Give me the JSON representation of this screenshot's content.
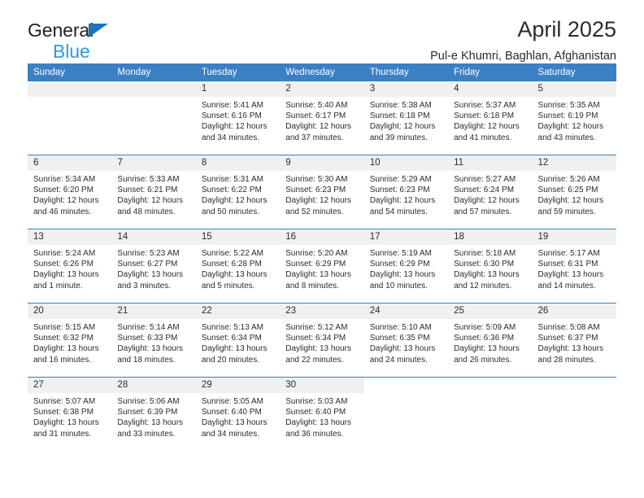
{
  "brand": {
    "line1": "General",
    "line2": "Blue",
    "triangle_color": "#1874bb",
    "line2_color": "#2e9bde"
  },
  "header": {
    "title": "April 2025",
    "subtitle": "Pul-e Khumri, Baghlan, Afghanistan"
  },
  "colors": {
    "header_band": "#3b7fc4",
    "daynum_band": "#f0f0f0",
    "text": "#2b2b2b"
  },
  "weekday_headers": [
    "Sunday",
    "Monday",
    "Tuesday",
    "Wednesday",
    "Thursday",
    "Friday",
    "Saturday"
  ],
  "weeks": [
    [
      {
        "day": "",
        "blank": true
      },
      {
        "day": "",
        "blank": true
      },
      {
        "day": "1",
        "sunrise": "Sunrise: 5:41 AM",
        "sunset": "Sunset: 6:16 PM",
        "daylight_line1": "Daylight: 12 hours",
        "daylight_line2": "and 34 minutes."
      },
      {
        "day": "2",
        "sunrise": "Sunrise: 5:40 AM",
        "sunset": "Sunset: 6:17 PM",
        "daylight_line1": "Daylight: 12 hours",
        "daylight_line2": "and 37 minutes."
      },
      {
        "day": "3",
        "sunrise": "Sunrise: 5:38 AM",
        "sunset": "Sunset: 6:18 PM",
        "daylight_line1": "Daylight: 12 hours",
        "daylight_line2": "and 39 minutes."
      },
      {
        "day": "4",
        "sunrise": "Sunrise: 5:37 AM",
        "sunset": "Sunset: 6:18 PM",
        "daylight_line1": "Daylight: 12 hours",
        "daylight_line2": "and 41 minutes."
      },
      {
        "day": "5",
        "sunrise": "Sunrise: 5:35 AM",
        "sunset": "Sunset: 6:19 PM",
        "daylight_line1": "Daylight: 12 hours",
        "daylight_line2": "and 43 minutes."
      }
    ],
    [
      {
        "day": "6",
        "sunrise": "Sunrise: 5:34 AM",
        "sunset": "Sunset: 6:20 PM",
        "daylight_line1": "Daylight: 12 hours",
        "daylight_line2": "and 46 minutes."
      },
      {
        "day": "7",
        "sunrise": "Sunrise: 5:33 AM",
        "sunset": "Sunset: 6:21 PM",
        "daylight_line1": "Daylight: 12 hours",
        "daylight_line2": "and 48 minutes."
      },
      {
        "day": "8",
        "sunrise": "Sunrise: 5:31 AM",
        "sunset": "Sunset: 6:22 PM",
        "daylight_line1": "Daylight: 12 hours",
        "daylight_line2": "and 50 minutes."
      },
      {
        "day": "9",
        "sunrise": "Sunrise: 5:30 AM",
        "sunset": "Sunset: 6:23 PM",
        "daylight_line1": "Daylight: 12 hours",
        "daylight_line2": "and 52 minutes."
      },
      {
        "day": "10",
        "sunrise": "Sunrise: 5:29 AM",
        "sunset": "Sunset: 6:23 PM",
        "daylight_line1": "Daylight: 12 hours",
        "daylight_line2": "and 54 minutes."
      },
      {
        "day": "11",
        "sunrise": "Sunrise: 5:27 AM",
        "sunset": "Sunset: 6:24 PM",
        "daylight_line1": "Daylight: 12 hours",
        "daylight_line2": "and 57 minutes."
      },
      {
        "day": "12",
        "sunrise": "Sunrise: 5:26 AM",
        "sunset": "Sunset: 6:25 PM",
        "daylight_line1": "Daylight: 12 hours",
        "daylight_line2": "and 59 minutes."
      }
    ],
    [
      {
        "day": "13",
        "sunrise": "Sunrise: 5:24 AM",
        "sunset": "Sunset: 6:26 PM",
        "daylight_line1": "Daylight: 13 hours",
        "daylight_line2": "and 1 minute."
      },
      {
        "day": "14",
        "sunrise": "Sunrise: 5:23 AM",
        "sunset": "Sunset: 6:27 PM",
        "daylight_line1": "Daylight: 13 hours",
        "daylight_line2": "and 3 minutes."
      },
      {
        "day": "15",
        "sunrise": "Sunrise: 5:22 AM",
        "sunset": "Sunset: 6:28 PM",
        "daylight_line1": "Daylight: 13 hours",
        "daylight_line2": "and 5 minutes."
      },
      {
        "day": "16",
        "sunrise": "Sunrise: 5:20 AM",
        "sunset": "Sunset: 6:29 PM",
        "daylight_line1": "Daylight: 13 hours",
        "daylight_line2": "and 8 minutes."
      },
      {
        "day": "17",
        "sunrise": "Sunrise: 5:19 AM",
        "sunset": "Sunset: 6:29 PM",
        "daylight_line1": "Daylight: 13 hours",
        "daylight_line2": "and 10 minutes."
      },
      {
        "day": "18",
        "sunrise": "Sunrise: 5:18 AM",
        "sunset": "Sunset: 6:30 PM",
        "daylight_line1": "Daylight: 13 hours",
        "daylight_line2": "and 12 minutes."
      },
      {
        "day": "19",
        "sunrise": "Sunrise: 5:17 AM",
        "sunset": "Sunset: 6:31 PM",
        "daylight_line1": "Daylight: 13 hours",
        "daylight_line2": "and 14 minutes."
      }
    ],
    [
      {
        "day": "20",
        "sunrise": "Sunrise: 5:15 AM",
        "sunset": "Sunset: 6:32 PM",
        "daylight_line1": "Daylight: 13 hours",
        "daylight_line2": "and 16 minutes."
      },
      {
        "day": "21",
        "sunrise": "Sunrise: 5:14 AM",
        "sunset": "Sunset: 6:33 PM",
        "daylight_line1": "Daylight: 13 hours",
        "daylight_line2": "and 18 minutes."
      },
      {
        "day": "22",
        "sunrise": "Sunrise: 5:13 AM",
        "sunset": "Sunset: 6:34 PM",
        "daylight_line1": "Daylight: 13 hours",
        "daylight_line2": "and 20 minutes."
      },
      {
        "day": "23",
        "sunrise": "Sunrise: 5:12 AM",
        "sunset": "Sunset: 6:34 PM",
        "daylight_line1": "Daylight: 13 hours",
        "daylight_line2": "and 22 minutes."
      },
      {
        "day": "24",
        "sunrise": "Sunrise: 5:10 AM",
        "sunset": "Sunset: 6:35 PM",
        "daylight_line1": "Daylight: 13 hours",
        "daylight_line2": "and 24 minutes."
      },
      {
        "day": "25",
        "sunrise": "Sunrise: 5:09 AM",
        "sunset": "Sunset: 6:36 PM",
        "daylight_line1": "Daylight: 13 hours",
        "daylight_line2": "and 26 minutes."
      },
      {
        "day": "26",
        "sunrise": "Sunrise: 5:08 AM",
        "sunset": "Sunset: 6:37 PM",
        "daylight_line1": "Daylight: 13 hours",
        "daylight_line2": "and 28 minutes."
      }
    ],
    [
      {
        "day": "27",
        "sunrise": "Sunrise: 5:07 AM",
        "sunset": "Sunset: 6:38 PM",
        "daylight_line1": "Daylight: 13 hours",
        "daylight_line2": "and 31 minutes."
      },
      {
        "day": "28",
        "sunrise": "Sunrise: 5:06 AM",
        "sunset": "Sunset: 6:39 PM",
        "daylight_line1": "Daylight: 13 hours",
        "daylight_line2": "and 33 minutes."
      },
      {
        "day": "29",
        "sunrise": "Sunrise: 5:05 AM",
        "sunset": "Sunset: 6:40 PM",
        "daylight_line1": "Daylight: 13 hours",
        "daylight_line2": "and 34 minutes."
      },
      {
        "day": "30",
        "sunrise": "Sunrise: 5:03 AM",
        "sunset": "Sunset: 6:40 PM",
        "daylight_line1": "Daylight: 13 hours",
        "daylight_line2": "and 36 minutes."
      },
      {
        "day": "",
        "void": true
      },
      {
        "day": "",
        "void": true
      },
      {
        "day": "",
        "void": true
      }
    ]
  ]
}
